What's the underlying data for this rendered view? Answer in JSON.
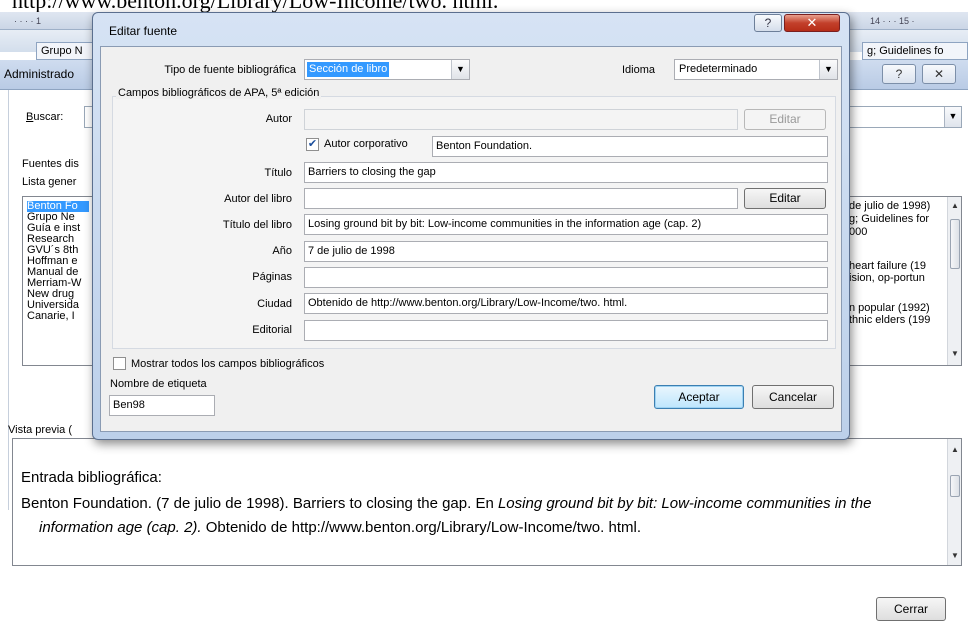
{
  "background": {
    "doc_url_text": "http://www.benton.org/Library/Low-Income/two. html.",
    "ruler_left": "· · · · 1",
    "ruler_right": "14 · · · 15 ·",
    "ribbon_left": "Grupo N",
    "ribbon_right": "g; Guidelines fo",
    "admin_title": "Administrado",
    "admin_help": "?",
    "admin_close": "✕",
    "search_label_u": "B",
    "search_label_rest": "uscar:",
    "sources_label": "Fuentes dis",
    "general_list_label": "Lista gener",
    "list_left": [
      "Benton Fo",
      "Grupo Ne",
      "Guía e inst",
      "Research",
      "GVU´s 8th",
      "Hoffman e",
      "Manual de",
      "Merriam-W",
      "New drug",
      "Universida",
      "Canarie, I"
    ],
    "list_right": [
      "de julio de 1998)",
      "g; Guidelines for",
      "000",
      "",
      "heart failure (19",
      "ision, op-portun",
      "",
      "n popular (1992)",
      "thnic elders (199",
      "",
      ""
    ],
    "preview_label": "Vista previa (",
    "preview_heading": "Entrada bibliográfica:",
    "preview_line1_plain": "Benton Foundation. (7 de julio de 1998).  Barriers to closing the gap. En ",
    "preview_line1_italic": "Losing ground bit by bit: Low-income communities in the",
    "preview_line2_italic": "information age (cap. 2).",
    "preview_line2_plain": " Obtenido de http://www.benton.org/Library/Low-Income/two. html.",
    "close_button": "Cerrar"
  },
  "dialog": {
    "title": "Editar fuente",
    "help_button": "?",
    "close_button": "✕",
    "source_type_label": "Tipo de fuente bibliográfica",
    "source_type_value": "Sección de libro",
    "language_label": "Idioma",
    "language_value": "Predeterminado",
    "group_title": "Campos bibliográficos de APA, 5ª edición",
    "fields": {
      "author_label": "Autor",
      "author_value": "",
      "author_edit_button": "Editar",
      "corporate_checkbox_label": "Autor corporativo",
      "corporate_checked": true,
      "corporate_value": "Benton Foundation.",
      "title_label": "Título",
      "title_value": "Barriers to closing the gap",
      "book_author_label": "Autor del libro",
      "book_author_value": "",
      "book_author_edit_button": "Editar",
      "book_title_label": "Título del libro",
      "book_title_value": "Losing ground bit by bit: Low-income communities in the information age (cap. 2)",
      "year_label": "Año",
      "year_value": "7 de julio de 1998",
      "pages_label": "Páginas",
      "pages_value": "",
      "city_label": "Ciudad",
      "city_value": "Obtenido de http://www.benton.org/Library/Low-Income/two. html.",
      "publisher_label": "Editorial",
      "publisher_value": ""
    },
    "show_all_fields_label": "Mostrar todos los campos bibliográficos",
    "tag_name_label": "Nombre de etiqueta",
    "tag_name_value": "Ben98",
    "ok_button": "Aceptar",
    "cancel_button": "Cancelar"
  },
  "colors": {
    "selection": "#3399ff",
    "dialog_frame": "#bcd0ea",
    "close_red": "#c3402b"
  }
}
